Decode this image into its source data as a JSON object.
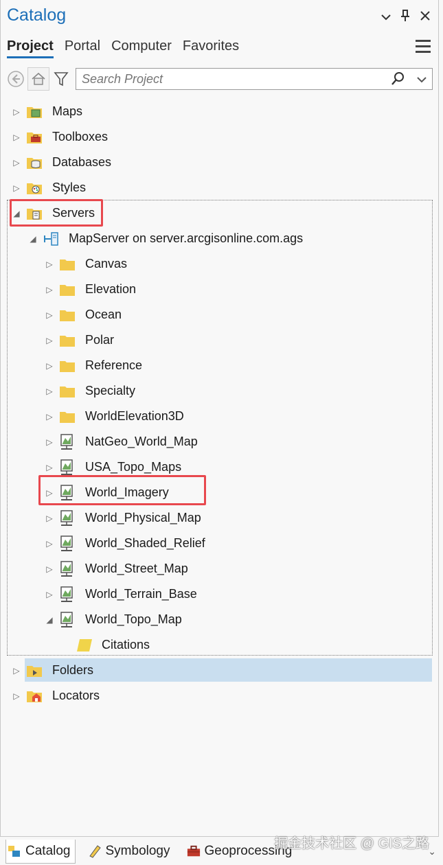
{
  "panel": {
    "title": "Catalog"
  },
  "tabs": [
    "Project",
    "Portal",
    "Computer",
    "Favorites"
  ],
  "search": {
    "placeholder": "Search Project"
  },
  "tree": {
    "maps": "Maps",
    "toolboxes": "Toolboxes",
    "databases": "Databases",
    "styles": "Styles",
    "servers": "Servers",
    "mapserver": "MapServer on server.arcgisonline.com.ags",
    "canvas": "Canvas",
    "elevation": "Elevation",
    "ocean": "Ocean",
    "polar": "Polar",
    "reference": "Reference",
    "specialty": "Specialty",
    "worldelevation3d": "WorldElevation3D",
    "natgeo": "NatGeo_World_Map",
    "usatopo": "USA_Topo_Maps",
    "worldimagery": "World_Imagery",
    "worldphysical": "World_Physical_Map",
    "worldshaded": "World_Shaded_Relief",
    "worldstreet": "World_Street_Map",
    "worldterrain": "World_Terrain_Base",
    "worldtopo": "World_Topo_Map",
    "citations": "Citations",
    "folders": "Folders",
    "locators": "Locators"
  },
  "bottom_tabs": [
    "Catalog",
    "Symbology",
    "Geoprocessing"
  ],
  "watermark": "掘金技术社区 @ GIS之路",
  "colors": {
    "accent": "#1d6fb8",
    "highlight": "#e8484e",
    "selection": "#c9deef",
    "folder": "#f2c94c"
  }
}
